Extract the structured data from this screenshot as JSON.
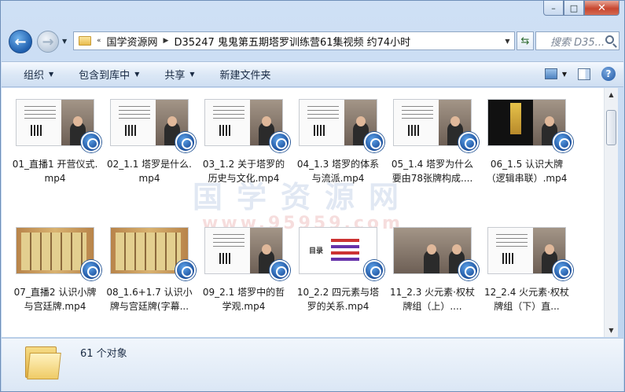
{
  "window": {
    "caption": {
      "minimize": "–",
      "maximize": "□",
      "close": "✕"
    }
  },
  "address": {
    "prefix": "«",
    "crumbs": [
      "国学资源网",
      "D35247 鬼鬼第五期塔罗训练营61集视频 约74小时"
    ],
    "search_placeholder": "搜索 D35..."
  },
  "toolbar": {
    "organize": "组织",
    "include_library": "包含到库中",
    "share": "共享",
    "new_folder": "新建文件夹"
  },
  "watermark": {
    "text": "国学资源网",
    "url": "www.95959.com"
  },
  "files": [
    {
      "name": "01_直播1 开营仪式.mp4",
      "thumb": "slide"
    },
    {
      "name": "02_1.1 塔罗是什么.mp4",
      "thumb": "slide"
    },
    {
      "name": "03_1.2 关于塔罗的历史与文化.mp4",
      "thumb": "slide"
    },
    {
      "name": "04_1.3 塔罗的体系与流派.mp4",
      "thumb": "slide"
    },
    {
      "name": "05_1.4 塔罗为什么要由78张牌构成....",
      "thumb": "slide"
    },
    {
      "name": "06_1.5 认识大牌（逻辑串联）.mp4",
      "thumb": "black"
    },
    {
      "name": "07_直播2 认识小牌与宫廷牌.mp4",
      "thumb": "cards"
    },
    {
      "name": "08_1.6+1.7 认识小牌与宫廷牌(字幕...",
      "thumb": "cards"
    },
    {
      "name": "09_2.1 塔罗中的哲学观.mp4",
      "thumb": "slide"
    },
    {
      "name": "10_2.2 四元素与塔罗的关系.mp4",
      "thumb": "toc"
    },
    {
      "name": "11_2.3 火元素·权杖牌组（上）....",
      "thumb": "scene"
    },
    {
      "name": "12_2.4 火元素·权杖牌组（下）直...",
      "thumb": "slide"
    }
  ],
  "toc_title": "目录",
  "status": {
    "count": "61 个对象"
  }
}
